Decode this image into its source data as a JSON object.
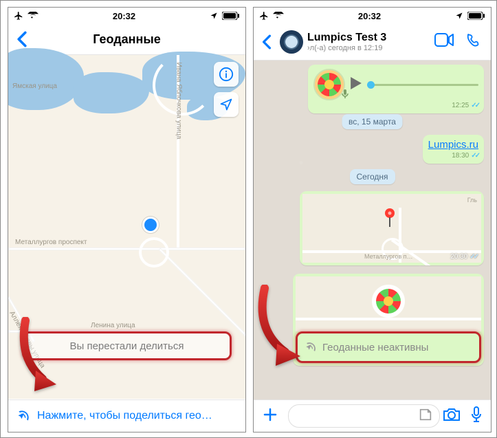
{
  "status_bar": {
    "time": "20:32"
  },
  "left": {
    "header": {
      "title": "Геоданные"
    },
    "map": {
      "labels": {
        "ivana": "Ивана Яблочкова улица",
        "yamskaya": "Ямская улица",
        "alleya": "Аллея Славы улица",
        "metallurgov": "Металлургов проспект",
        "lenina": "Ленина улица"
      }
    },
    "stopped_toast": "Вы перестали делиться",
    "share_cta": "Нажмите, чтобы поделиться гео…"
  },
  "right": {
    "chat_header": {
      "name": "Lumpics Test 3",
      "status": "›л(-а) сегодня в 12:19"
    },
    "voice": {
      "duration": "12:25"
    },
    "date_pill_1": "вс, 15 марта",
    "link_msg": {
      "text": "Lumpics.ru",
      "time": "18:30"
    },
    "date_pill_2": "Сегодня",
    "map_msg": {
      "label_top": "Гль",
      "label_bottom": "Металлургов п…",
      "time": "20:30"
    },
    "live_msg": {
      "text": "Геоданные неактивны"
    }
  }
}
